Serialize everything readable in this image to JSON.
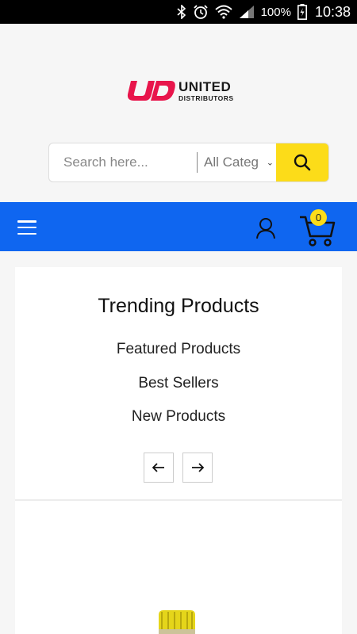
{
  "status_bar": {
    "battery_percent": "100%",
    "time": "10:38",
    "icons": [
      "bluetooth-icon",
      "alarm-icon",
      "wifi-icon",
      "signal-icon",
      "battery-icon"
    ]
  },
  "logo": {
    "line1": "UNITED",
    "line2": "DISTRIBUTORS",
    "brand_color": "#e8154b"
  },
  "search": {
    "placeholder": "Search here...",
    "category_value": "All Categ",
    "button_color": "#fcdc19"
  },
  "nav": {
    "background": "#0f66f0",
    "cart_count": "0"
  },
  "trending": {
    "title": "Trending Products",
    "tabs": [
      "Featured Products",
      "Best Sellers",
      "New Products"
    ]
  }
}
